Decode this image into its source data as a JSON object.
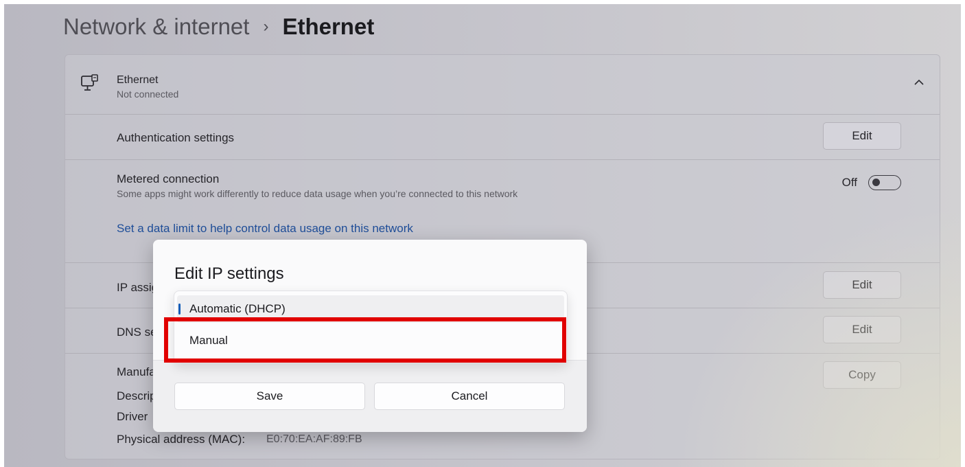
{
  "breadcrumb": {
    "parent": "Network & internet",
    "separator": "›",
    "current": "Ethernet"
  },
  "ethernet": {
    "title": "Ethernet",
    "status": "Not connected"
  },
  "auth": {
    "label": "Authentication settings",
    "button": "Edit"
  },
  "metered": {
    "label": "Metered connection",
    "description": "Some apps might work differently to reduce data usage when you’re connected to this network",
    "toggle_state": "Off",
    "link": "Set a data limit to help control data usage on this network"
  },
  "ip_assignment": {
    "label": "IP assig",
    "button": "Edit"
  },
  "dns": {
    "label": "DNS se",
    "button": "Edit"
  },
  "properties": {
    "rows": [
      "Manufa",
      "Descrip",
      "Driver "
    ],
    "mac_label": "Physical address (MAC):",
    "mac_value": "E0:70:EA:AF:89:FB",
    "copy_button": "Copy"
  },
  "dialog": {
    "title": "Edit IP settings",
    "options": [
      "Automatic (DHCP)",
      "Manual"
    ],
    "selected": "Automatic (DHCP)",
    "save": "Save",
    "cancel": "Cancel"
  },
  "colors": {
    "accent": "#0f5cb8",
    "link": "#1f4e99",
    "highlight": "#e10000"
  }
}
